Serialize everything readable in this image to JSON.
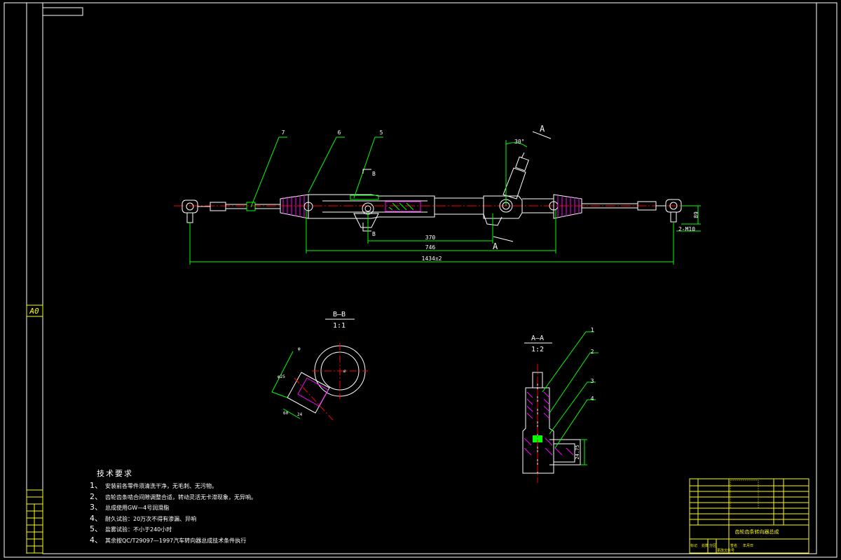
{
  "sheet": {
    "size_label": "A0"
  },
  "main_view": {
    "balloons": [
      "7",
      "6",
      "5"
    ],
    "section_marks": {
      "a": "A",
      "b": "B"
    },
    "angle_dim": "30°",
    "dims": {
      "d370": "370",
      "d746": "746",
      "d1434": "1434±2",
      "d89": "89",
      "thread": "2-M10"
    }
  },
  "section_bb": {
    "title": "B—B",
    "scale": "1:1",
    "dims": {
      "d1": "φ",
      "d2": "φ25",
      "d3": "60",
      "d4": "ø",
      "d5": "24"
    }
  },
  "section_aa": {
    "title": "A—A",
    "scale": "1:2",
    "balloons": [
      "1",
      "2",
      "3",
      "4"
    ],
    "dim": "24.75"
  },
  "tech_notes": {
    "title": "技术要求",
    "items": [
      {
        "num": "1、",
        "text": "安装前各零件须清洗干净，无毛刺、无污物。"
      },
      {
        "num": "2、",
        "text": "齿轮齿条啮合间隙调整合适，转动灵活无卡滞现象，无异响。"
      },
      {
        "num": "3、",
        "text": "总成使用GW—4号润滑脂"
      },
      {
        "num": "4、",
        "text": "耐久试验：20万次不得有渗漏、异响"
      },
      {
        "num": "5、",
        "text": "盐雾试验：不小于240小时"
      },
      {
        "num": "4、",
        "text": "其余按QC/T29097—1997汽车转向器总成技术条件执行"
      }
    ]
  },
  "title_block": {
    "drawing_name": "齿轮齿条转向器总成",
    "columns": [
      "标记",
      "处数",
      "分区",
      "更改文件号",
      "签名",
      "年月日"
    ]
  },
  "colors": {
    "frame": "#ffffff",
    "geometry": "#ffffff",
    "dimension": "#00ff00",
    "centerline": "#ff0000",
    "titleblock": "#ffff00",
    "hatch": "#ff00ff"
  }
}
